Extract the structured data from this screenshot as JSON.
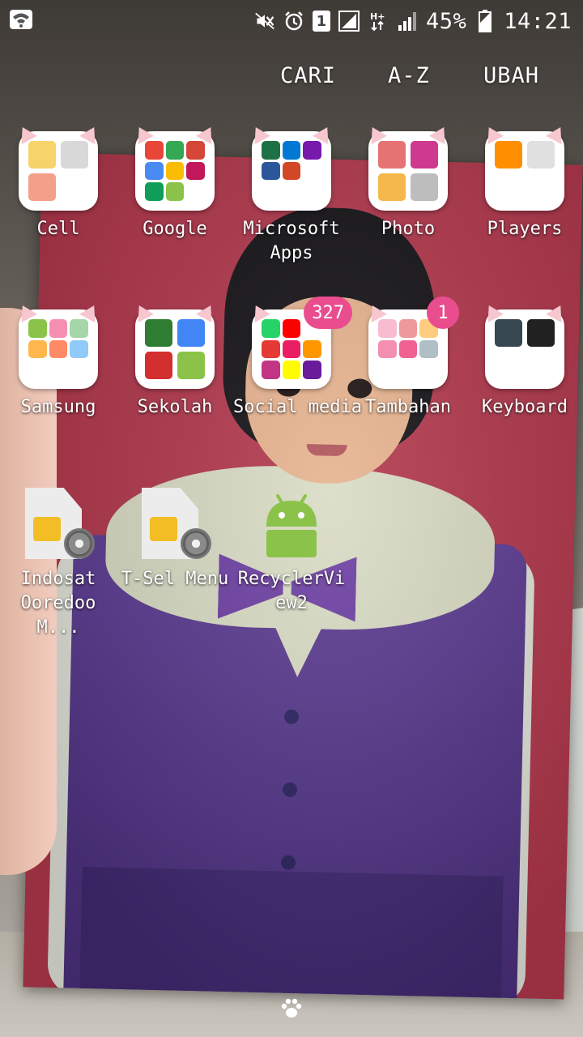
{
  "status_bar": {
    "battery_percent": "45%",
    "time": "14:21",
    "sim_slot": "1",
    "icons": [
      "wifi-icon",
      "mute-icon",
      "alarm-icon",
      "sim-1-icon",
      "signal-1-icon",
      "hplus-data-icon",
      "signal-2-icon",
      "battery-icon"
    ]
  },
  "top_menu": {
    "search": "CARI",
    "sort": "A-Z",
    "edit": "UBAH"
  },
  "apps": {
    "row1": [
      {
        "label": "Cell"
      },
      {
        "label": "Google"
      },
      {
        "label": "Microsoft Apps"
      },
      {
        "label": "Photo"
      },
      {
        "label": "Players"
      }
    ],
    "row2": [
      {
        "label": "Samsung"
      },
      {
        "label": "Sekolah"
      },
      {
        "label": "Social media",
        "badge": "327"
      },
      {
        "label": "Tambahan",
        "badge": "1"
      },
      {
        "label": "Keyboard"
      }
    ],
    "row3": [
      {
        "label": "Indosat Ooredoo M..."
      },
      {
        "label": "T-Sel Menu"
      },
      {
        "label": "RecyclerView2"
      }
    ]
  },
  "colors": {
    "badge": "#e94d8e",
    "folder_ears": "#f6c7cf",
    "android_green": "#8bc34a"
  }
}
